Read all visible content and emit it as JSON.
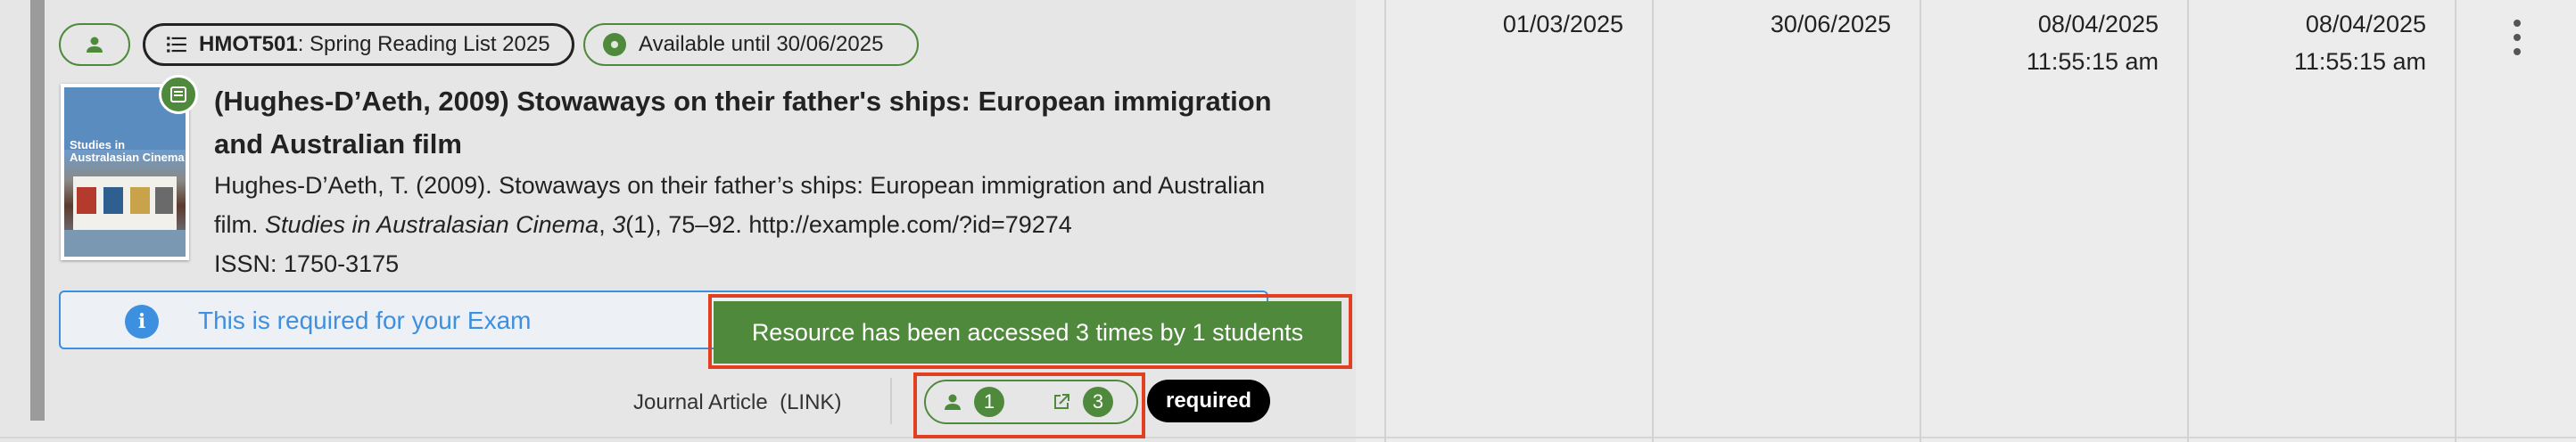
{
  "chips": {
    "module_code": "HMOT501",
    "module_list": ": Spring Reading List 2025",
    "availability": "Available until 30/06/2025"
  },
  "item": {
    "title": "(Hughes-D’Aeth, 2009) Stowaways on their father's ships: European immigration and Australian film",
    "citation_authors": "Hughes-D’Aeth, T. (2009). Stowaways on their father’s ships: European immigration and Australian film. ",
    "citation_journal": "Studies in Australasian Cinema",
    "citation_sep": ", ",
    "citation_volume": "3",
    "citation_rest": "(1), 75–92. http://example.com/?id=79274",
    "issn": "ISSN: 1750-3175",
    "cover_title": "Studies in Australasian Cinema"
  },
  "note": {
    "icon_glyph": "i",
    "text": "This is required for your Exam"
  },
  "toast": {
    "text": "Resource has been accessed 3 times by 1 students"
  },
  "footer": {
    "type": "Journal Article",
    "link": "(LINK)",
    "students_count": "1",
    "access_count": "3",
    "importance": "required"
  },
  "columns": {
    "date1": "01/03/2025",
    "date2": "30/06/2025",
    "date3": "08/04/2025",
    "time3": "11:55:15 am",
    "date4": "08/04/2025",
    "time4": "11:55:15 am"
  },
  "colors": {
    "accent_green": "#4f8a3c",
    "info_blue": "#3d8fe0",
    "highlight_red": "#e0401f"
  }
}
